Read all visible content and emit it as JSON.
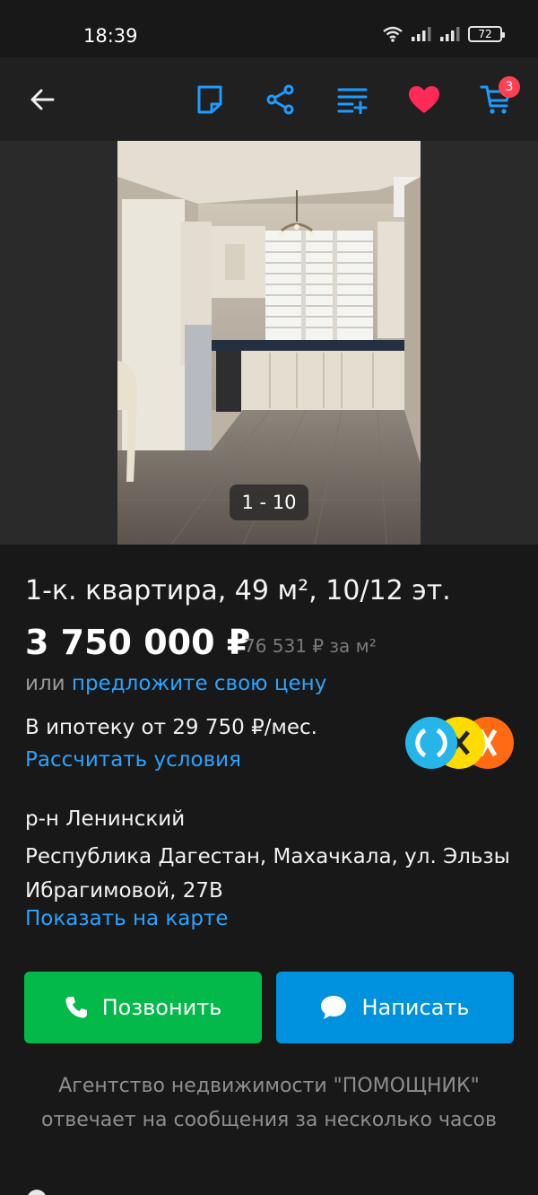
{
  "status_bar": {
    "time": "18:39",
    "battery": "72"
  },
  "app_bar": {
    "cart_count": "3"
  },
  "gallery": {
    "counter": "1 - 10"
  },
  "listing": {
    "title": "1-к. квартира, 49 м², 10/12 эт.",
    "price": "3 750 000 ₽",
    "price_per_m2": "76 531 ₽ за м²",
    "offer_prefix": "или",
    "offer_link": "предложите свою цену",
    "mortgage_text": "В ипотеку от 29 750 ₽/мес.",
    "mortgage_link": "Рассчитать условия",
    "district": "р-н Ленинский",
    "address": "Республика Дагестан, Махачкала, ул. Эльзы Ибрагимовой, 27В",
    "map_link": "Показать на карте"
  },
  "actions": {
    "call_label": "Позвонить",
    "write_label": "Написать"
  },
  "agency_note": {
    "line1": "Агентство недвижимости \"ПОМОЩНИК\"",
    "line2": "отвечает на сообщения за несколько часов"
  },
  "colors": {
    "accent_link": "#2aa4ff",
    "call_button": "#02b94a",
    "write_button": "#0091df",
    "favorite": "#ff2a55",
    "icon_blue": "#1e9bff"
  },
  "icons": [
    "back-arrow-icon",
    "note-icon",
    "share-icon",
    "compare-icon",
    "heart-icon",
    "cart-icon",
    "phone-icon",
    "chat-icon"
  ]
}
